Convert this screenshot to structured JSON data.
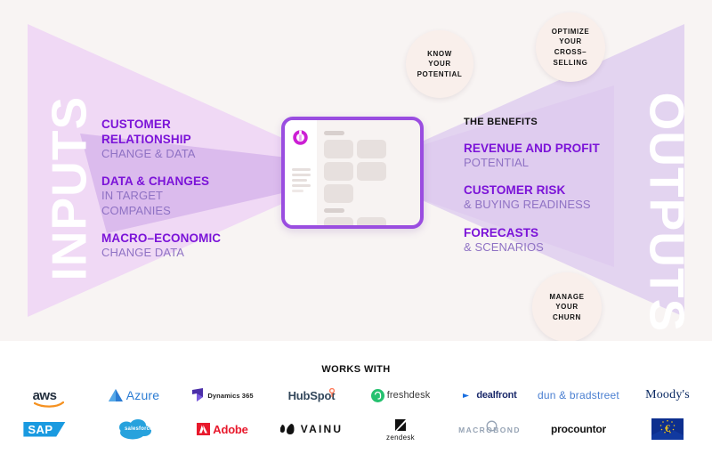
{
  "colors": {
    "page_bg": "#ffffff",
    "diagram_bg": "#f8f4f3",
    "triangle_light": "#f0d9f5",
    "triangle_mid": "#e3d4f0",
    "triangle_dark": "#d9b8ec",
    "accent_purple": "#7b13d8",
    "accent_purple_soft": "#8f72c4",
    "device_border": "#9a4de0",
    "bubble_fill": "#f9efeb",
    "logo_mark": "#cc1fd4"
  },
  "diagram": {
    "left_side_label": "INPUTS",
    "right_side_label": "OUTPUTS",
    "inputs": [
      {
        "headline": "CUSTOMER\nRELATIONSHIP",
        "sub": "CHANGE & DATA"
      },
      {
        "headline": "DATA & CHANGES",
        "sub": "IN TARGET\nCOMPANIES"
      },
      {
        "headline": "MACRO–ECONOMIC",
        "sub": "CHANGE DATA"
      }
    ],
    "benefits_heading": "THE BENEFITS",
    "benefits": [
      {
        "headline": "REVENUE AND PROFIT",
        "sub": "POTENTIAL"
      },
      {
        "headline": "CUSTOMER RISK",
        "sub": "& BUYING READINESS"
      },
      {
        "headline": "FORECASTS",
        "sub": "& SCENARIOS"
      }
    ],
    "bubbles": [
      {
        "text": "KNOW\nYOUR\nPOTENTIAL"
      },
      {
        "text": "OPTIMIZE\nYOUR\nCROSS–\nSELLING"
      },
      {
        "text": "MANAGE\nYOUR\nCHURN"
      }
    ],
    "device": {
      "logo_icon": "ring-notch-logo-icon",
      "sidebar_lines": 5,
      "section_one_tiles": 5,
      "section_two_tiles": 3
    }
  },
  "partners": {
    "heading": "WORKS WITH",
    "row1": [
      {
        "name": "aws",
        "label": "aws"
      },
      {
        "name": "azure",
        "label": "Azure"
      },
      {
        "name": "dynamics-365",
        "label": "Dynamics 365"
      },
      {
        "name": "hubspot",
        "label": "HubSpot"
      },
      {
        "name": "freshdesk",
        "label": "freshdesk"
      },
      {
        "name": "dealfront",
        "label": "dealfront"
      },
      {
        "name": "dun-bradstreet",
        "label": "dun & bradstreet"
      },
      {
        "name": "moodys",
        "label": "Moody's"
      }
    ],
    "row2": [
      {
        "name": "sap",
        "label": "SAP"
      },
      {
        "name": "salesforce",
        "label": "salesforce"
      },
      {
        "name": "adobe",
        "label": "Adobe"
      },
      {
        "name": "vainu",
        "label": "VAINU"
      },
      {
        "name": "zendesk",
        "label": "zendesk"
      },
      {
        "name": "macrobond",
        "label": "MACROBOND"
      },
      {
        "name": "procountor",
        "label": "procountor"
      },
      {
        "name": "european-central-bank",
        "label": ""
      }
    ]
  }
}
